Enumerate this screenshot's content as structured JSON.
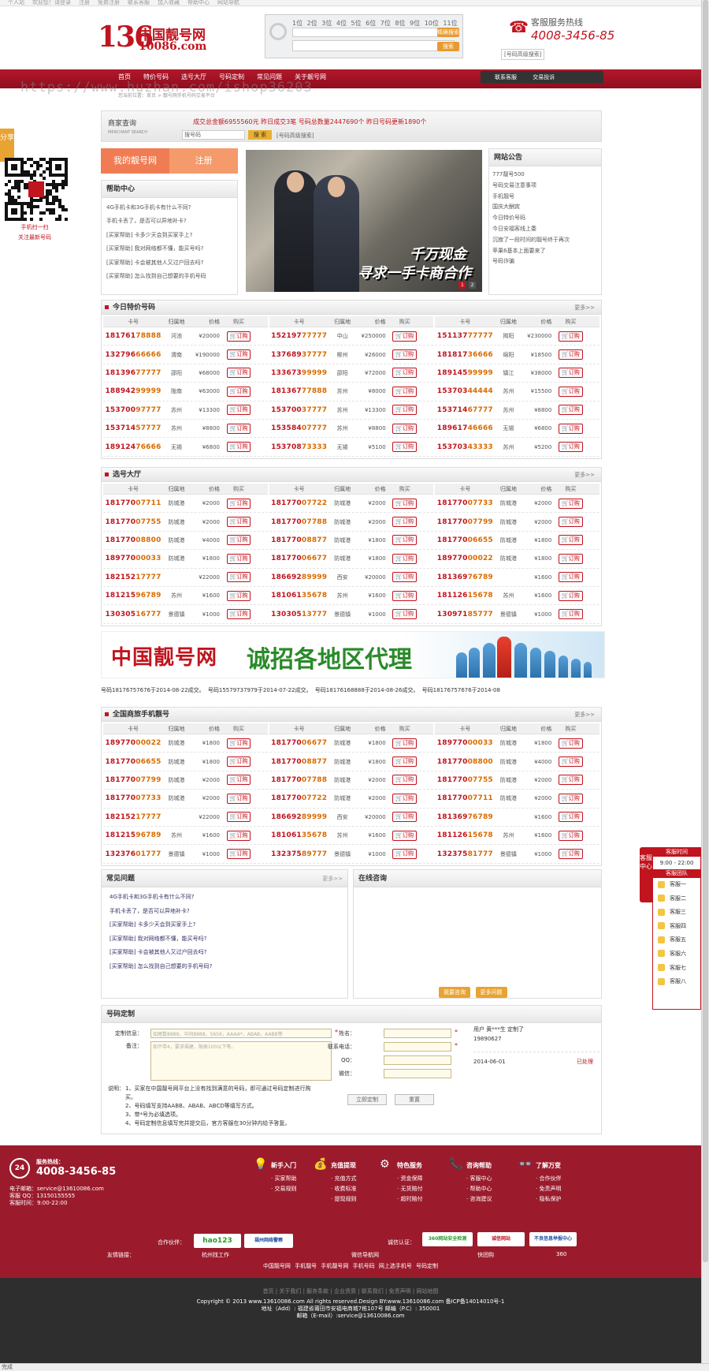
{
  "topbar": {
    "items": [
      "个人站",
      "欢迎您！请登录",
      "注册",
      "免费注册",
      "联系客服",
      "加入收藏",
      "帮助中心",
      "网站导航"
    ]
  },
  "header": {
    "logo_num": "136",
    "logo_cn": "中国靓号网",
    "logo_domain": "10086.com",
    "search_digits": "1位 2位 3位 4位 5位 6位 7位 8位 9位 10位 11位",
    "search_btn1": "精确搜索",
    "search_btn2": "搜索",
    "hotline_title": "客服服务热线",
    "hotline_number": "4008-3456-85",
    "advanced_search": "[号码高级搜索]"
  },
  "nav": {
    "items": [
      "首页",
      "特价号码",
      "选号大厅",
      "号码定制",
      "常见问题",
      "关于靓号网"
    ],
    "contact": "联系客服",
    "complaint": "交易投诉"
  },
  "watermark": "https://www.huzhan.com/ishop36203",
  "breadcrumb": "您当前位置：首页 > 靓号网手机号码交易平台",
  "merchant": {
    "title": "商家查询",
    "subtitle": "MERCHANT SEARCH",
    "stats": "成交总金额6955560元 昨日成交3笔 号码总数量2447690个 昨日号码更新1890个",
    "input_placeholder": "搜号码",
    "btn": "搜 索",
    "link": "[号码高级搜索]"
  },
  "share_tab": "分享",
  "qr_caption": [
    "手机扫一扫",
    "关注最新号码"
  ],
  "user_tabs": {
    "mine": "我的靓号网",
    "register": "注册"
  },
  "help": {
    "title": "帮助中心",
    "items": [
      "4G手机卡和3G手机卡有什么不同?",
      "手机卡丢了，是否可以异地补卡?",
      "[买家帮助] 卡多少天会到买家手上?",
      "[买家帮助] 我对网络都不懂，能买号吗?",
      "[买家帮助] 卡会被其他人又过户回去吗?",
      "[买家帮助] 怎么找到自己想要的手机号码"
    ]
  },
  "banner": {
    "line1": "千万现金",
    "line2": "寻求一手卡商合作",
    "dot1": "1",
    "dot2": "2"
  },
  "notice": {
    "title": "网站公告",
    "items": [
      "777靓号500",
      "号码交易注意事项",
      "手机靓号",
      "国庆大酬宾",
      "今日特价号码",
      "今日安福客线上委",
      "沉寂了一段时间的靓号终于再次",
      "苹果6基本上面要来了",
      "号码诈骗"
    ]
  },
  "table_headers": {
    "num": "卡号",
    "area": "归属地",
    "price": "价格",
    "buy": "购买"
  },
  "order_label": "订购",
  "more_label": "更多>>",
  "special": {
    "title": "今日特价号码",
    "columns": [
      [
        [
          "18176178888",
          "河池",
          "¥20000"
        ],
        [
          "13279666666",
          "渭南",
          "¥190000"
        ],
        [
          "18139677777",
          "邵阳",
          "¥68000"
        ],
        [
          "18894299999",
          "陇南",
          "¥63000"
        ],
        [
          "15370097777",
          "苏州",
          "¥13300"
        ],
        [
          "15371457777",
          "苏州",
          "¥8800"
        ],
        [
          "18912476666",
          "无锡",
          "¥6800"
        ]
      ],
      [
        [
          "15219777777",
          "中山",
          "¥250000"
        ],
        [
          "13768937777",
          "柳州",
          "¥26000"
        ],
        [
          "13367399999",
          "邵阳",
          "¥72000"
        ],
        [
          "18136777888",
          "苏州",
          "¥8000"
        ],
        [
          "15370037777",
          "苏州",
          "¥13300"
        ],
        [
          "15358407777",
          "苏州",
          "¥8800"
        ],
        [
          "15370873333",
          "无锡",
          "¥5100"
        ]
      ],
      [
        [
          "15113777777",
          "揭阳",
          "¥230000"
        ],
        [
          "18181736666",
          "绵阳",
          "¥18500"
        ],
        [
          "18914599999",
          "镇江",
          "¥38000"
        ],
        [
          "15370344444",
          "苏州",
          "¥15500"
        ],
        [
          "15371467777",
          "苏州",
          "¥8800"
        ],
        [
          "18961746666",
          "无锡",
          "¥6800"
        ],
        [
          "15370343333",
          "苏州",
          "¥5200"
        ]
      ]
    ]
  },
  "hall": {
    "title": "选号大厅",
    "columns": [
      [
        [
          "18177007711",
          "防城港",
          "¥2000"
        ],
        [
          "18177007755",
          "防城港",
          "¥2000"
        ],
        [
          "18177008800",
          "防城港",
          "¥4000"
        ],
        [
          "18977000033",
          "防城港",
          "¥1800"
        ],
        [
          "18215217777",
          "",
          "¥22000"
        ],
        [
          "18121596789",
          "苏州",
          "¥1600"
        ],
        [
          "13030516777",
          "景德镇",
          "¥1000"
        ]
      ],
      [
        [
          "18177007722",
          "防城港",
          "¥2000"
        ],
        [
          "18177007788",
          "防城港",
          "¥2000"
        ],
        [
          "18177008877",
          "防城港",
          "¥1800"
        ],
        [
          "18177006677",
          "防城港",
          "¥1800"
        ],
        [
          "18669289999",
          "西安",
          "¥20000"
        ],
        [
          "18106135678",
          "苏州",
          "¥1600"
        ],
        [
          "13030513777",
          "景德镇",
          "¥1000"
        ]
      ],
      [
        [
          "18177007733",
          "防城港",
          "¥2000"
        ],
        [
          "18177007799",
          "防城港",
          "¥2000"
        ],
        [
          "18177006655",
          "防城港",
          "¥1800"
        ],
        [
          "18977000022",
          "防城港",
          "¥1800"
        ],
        [
          "18136976789",
          "",
          "¥1600"
        ],
        [
          "18112615678",
          "苏州",
          "¥1600"
        ],
        [
          "13097185777",
          "景德镇",
          "¥1000"
        ]
      ]
    ]
  },
  "agent_banner": {
    "t1": "中国靓号网",
    "t2": "诚招各地区代理"
  },
  "ticker": "号码18176757676于2014-08-22成交。    号码15579737979于2014-07-22成交。    号码18176168888于2014-08-26成交。    号码18176757676于2014-08",
  "national": {
    "title": "全国商旅手机靓号",
    "columns": [
      [
        [
          "18977000022",
          "防城港",
          "¥1800"
        ],
        [
          "18177006655",
          "防城港",
          "¥1800"
        ],
        [
          "18177007799",
          "防城港",
          "¥2000"
        ],
        [
          "18177007733",
          "防城港",
          "¥2000"
        ],
        [
          "18215217777",
          "",
          "¥22000"
        ],
        [
          "18121596789",
          "苏州",
          "¥1600"
        ],
        [
          "13237601777",
          "景德镇",
          "¥1000"
        ]
      ],
      [
        [
          "18177006677",
          "防城港",
          "¥1800"
        ],
        [
          "18177008877",
          "防城港",
          "¥1800"
        ],
        [
          "18177007788",
          "防城港",
          "¥2000"
        ],
        [
          "18177007722",
          "防城港",
          "¥2000"
        ],
        [
          "18669289999",
          "西安",
          "¥20000"
        ],
        [
          "18106135678",
          "苏州",
          "¥1600"
        ],
        [
          "13237589777",
          "景德镇",
          "¥1000"
        ]
      ],
      [
        [
          "18977000033",
          "防城港",
          "¥1800"
        ],
        [
          "18177008800",
          "防城港",
          "¥4000"
        ],
        [
          "18177007755",
          "防城港",
          "¥2000"
        ],
        [
          "18177007711",
          "防城港",
          "¥2000"
        ],
        [
          "18136976789",
          "",
          "¥1600"
        ],
        [
          "18112615678",
          "苏州",
          "¥1600"
        ],
        [
          "13237581777",
          "景德镇",
          "¥1000"
        ]
      ]
    ]
  },
  "faq": {
    "title": "常见问题",
    "more": "更多>>",
    "items": [
      "4G手机卡和3G手机卡有什么不同?",
      "手机卡丢了，是否可以异地补卡?",
      "[买家帮助] 卡多少天会到买家手上?",
      "[买家帮助] 我对网络都不懂，能买号吗?",
      "[买家帮助] 卡会被其他人又过户回去吗?",
      "[买家帮助] 怎么找到自己想要的手机号码?"
    ]
  },
  "consult": {
    "title": "在线咨询",
    "btn1": "我要咨询",
    "btn2": "更多问题"
  },
  "custom": {
    "title": "号码定制",
    "info_label": "定制信息：",
    "info_placeholder": "如尾数8888，中间8888，5656，AAAA*，ABAB，AABB等",
    "remark_label": "备注：",
    "remark_placeholder": "如不带4，要求福建，限高100以下等。",
    "name_label": "姓名：",
    "phone_label": "联系电话：",
    "qq_label": "QQ：",
    "wechat_label": "微信：",
    "note_title": "说明：",
    "notes": [
      "1、买家在中国靓号网平台上没有找到满意的号码，即可通过号码定制进行购买。",
      "2、号码填写支持AABB、ABAB、ABCD等填写方式。",
      "3、带*号为必填选项。",
      "4、号码定制信息填写完并提交后，官方客服在30分钟内给予答复。"
    ],
    "submit": "立即定制",
    "reset": "重置",
    "side_user": "用户 黄***生 定制了",
    "side_num": "19890627",
    "side_date": "2014-06-01",
    "side_status": "已处理"
  },
  "kefu": {
    "tab": "客服中心",
    "time_title": "客服时间",
    "time": "9:00 - 22:00",
    "team_title": "客服团队",
    "agents": [
      "客服一",
      "客服二",
      "客服三",
      "客服四",
      "客服五",
      "客服六",
      "客服七",
      "客服八"
    ]
  },
  "footer": {
    "hot_title": "服务热线：",
    "hot_number": "4008-3456-85",
    "email": "电子邮箱：service@13610086.com",
    "qq": "客服 QQ：13150155555",
    "hours": "客服时间：9:00-22:00",
    "cols": [
      {
        "title": "新手入门",
        "items": [
          "· 买家帮助",
          "· 交易规则"
        ]
      },
      {
        "title": "充值提现",
        "items": [
          "· 充值方式",
          "· 收费标准",
          "· 提现规则"
        ]
      },
      {
        "title": "特色服务",
        "items": [
          "· 资金保障",
          "· 无货赔付",
          "· 超时赔付"
        ]
      },
      {
        "title": "咨询帮助",
        "items": [
          "· 客服中心",
          "· 帮助中心",
          "· 咨询建议"
        ]
      },
      {
        "title": "了解万变",
        "items": [
          "· 合作伙伴",
          "· 免责声明",
          "· 隐私保护"
        ]
      }
    ],
    "partners_label": "合作伙伴：",
    "partner1": "hao123",
    "partner2": "福州网络警察",
    "trust_label": "诚信认证：",
    "trust1": "360网站安全检测",
    "trust2": "诚信网站",
    "trust3": "不良信息举报中心",
    "friend_label": "友情链接：",
    "friends": [
      "杭州找工作",
      "微信导航网",
      "快团购",
      "360"
    ],
    "links": "中国靓号网   手机靓号   手机靓号网   手机号码   网上选手机号   号码定制"
  },
  "bottom": {
    "links": "首页 | 关于我们 | 服务条款 | 企业资质 | 联系我们 | 免责声明 | 网站地图",
    "copy1": "Copyright © 2013 www.13610086.com All rights reserved.Design BY:www.13610086.com 备ICP备14014010号-1",
    "copy2": "地址（Add）: 福建省莆田市安福电商城7栋107号 邮编（P.C）: 350001",
    "copy3": "邮箱（E-mail）:service@13610086.com"
  },
  "statusbar": "完成",
  "colors": {
    "brand": "#c0141e",
    "nav": "#9b1b2c",
    "orange": "#e79a2f",
    "tab_orange": "#f07c54"
  }
}
